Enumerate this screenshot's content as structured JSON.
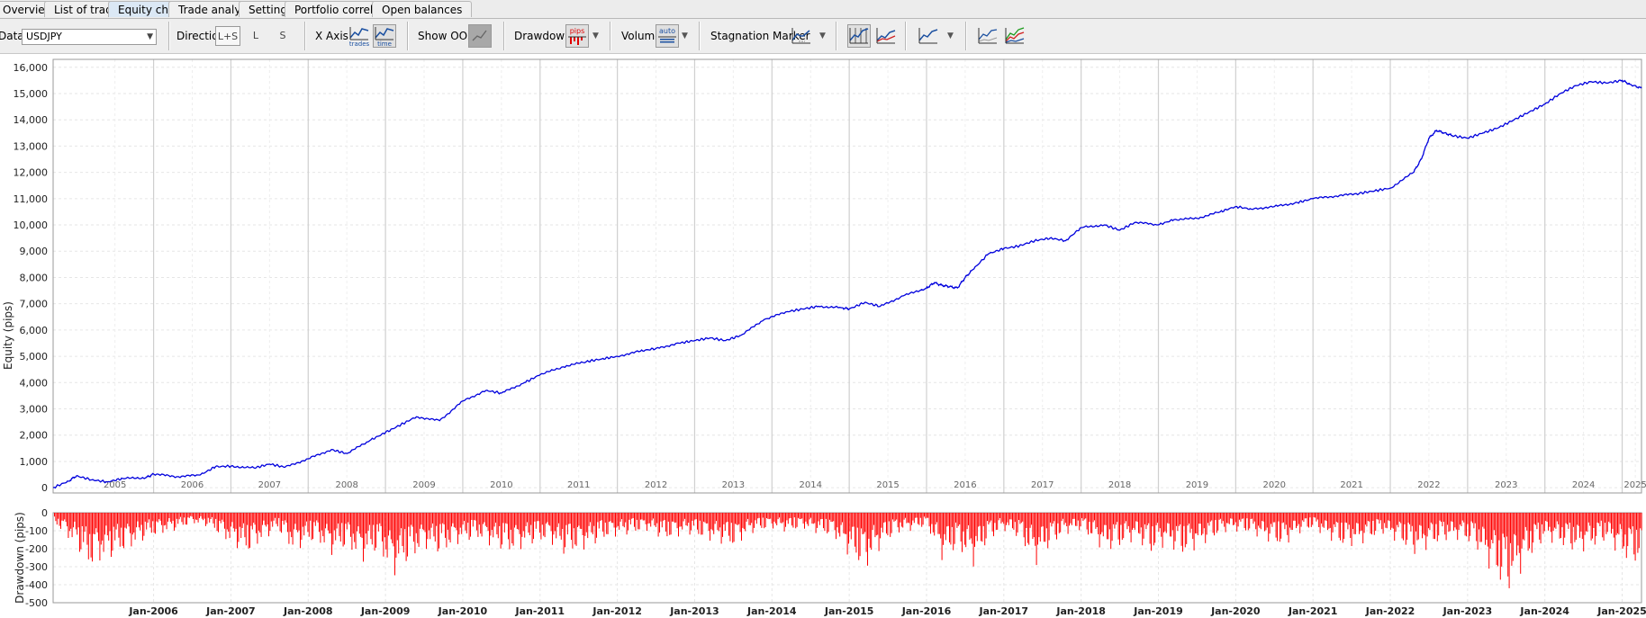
{
  "tabs": [
    {
      "label": "Overview",
      "active": false
    },
    {
      "label": "List of trades",
      "active": false
    },
    {
      "label": "Equity chart",
      "active": true
    },
    {
      "label": "Trade analysis",
      "active": false
    },
    {
      "label": "Settings",
      "active": false
    },
    {
      "label": "Portfolio correlation",
      "active": false
    },
    {
      "label": "Open balances",
      "active": false
    }
  ],
  "toolbar": {
    "data_label": "Data",
    "data_value": "USDJPY",
    "direction_label": "Direction",
    "direction_options": [
      "L+S",
      "L",
      "S"
    ],
    "direction_selected": "L+S",
    "xaxis_label": "X Axis",
    "xaxis_trades_icon_text": "trades",
    "xaxis_time_icon_text": "time",
    "show_oos_label": "Show OOS",
    "drawdown_label": "Drawdown",
    "drawdown_icon_text": "pips",
    "volume_label": "Volume",
    "volume_icon_text": "auto",
    "stagnation_label": "Stagnation Marker"
  },
  "colors": {
    "equity_line": "#0000dd",
    "drawdown_fill": "#ff0000",
    "active_tab": "#dbe8f5"
  },
  "chart_data": [
    {
      "type": "line",
      "ylabel": "Equity (pips)",
      "ylim": [
        -200,
        16300
      ],
      "yticks": [
        0,
        1000,
        2000,
        3000,
        4000,
        5000,
        6000,
        7000,
        8000,
        9000,
        10000,
        11000,
        12000,
        13000,
        14000,
        15000,
        16000
      ],
      "xlim": [
        2004.7,
        2025.25
      ],
      "year_labels": [
        "2005",
        "2006",
        "2007",
        "2008",
        "2009",
        "2010",
        "2011",
        "2012",
        "2013",
        "2014",
        "2015",
        "2016",
        "2017",
        "2018",
        "2019",
        "2020",
        "2021",
        "2022",
        "2023",
        "2024",
        "2025"
      ],
      "grid": true,
      "series": [
        {
          "x": [
            2004.7,
            2004.9,
            2005.0,
            2005.2,
            2005.4,
            2005.6,
            2005.9,
            2006.0,
            2006.3,
            2006.6,
            2006.8,
            2007.0,
            2007.3,
            2007.5,
            2007.7,
            2008.0,
            2008.3,
            2008.5,
            2008.8,
            2009.0,
            2009.2,
            2009.4,
            2009.7,
            2010.0,
            2010.3,
            2010.5,
            2010.8,
            2011.0,
            2011.3,
            2011.6,
            2011.8,
            2012.0,
            2012.3,
            2012.5,
            2012.8,
            2013.0,
            2013.2,
            2013.4,
            2013.6,
            2013.9,
            2014.2,
            2014.4,
            2014.6,
            2014.9,
            2015.0,
            2015.2,
            2015.4,
            2015.7,
            2016.0,
            2016.1,
            2016.2,
            2016.3,
            2016.4,
            2016.5,
            2016.6,
            2016.8,
            2017.0,
            2017.2,
            2017.4,
            2017.6,
            2017.8,
            2018.0,
            2018.3,
            2018.5,
            2018.7,
            2019.0,
            2019.2,
            2019.5,
            2019.8,
            2020.0,
            2020.2,
            2020.5,
            2020.8,
            2021.0,
            2021.3,
            2021.6,
            2021.8,
            2022.0,
            2022.3,
            2022.4,
            2022.5,
            2022.6,
            2022.7,
            2022.8,
            2023.0,
            2023.2,
            2023.4,
            2023.6,
            2023.8,
            2024.0,
            2024.2,
            2024.4,
            2024.6,
            2024.8,
            2025.0,
            2025.1,
            2025.25
          ],
          "y": [
            0,
            250,
            450,
            300,
            220,
            350,
            380,
            520,
            420,
            480,
            800,
            820,
            750,
            900,
            780,
            1100,
            1450,
            1300,
            1800,
            2100,
            2400,
            2700,
            2550,
            3300,
            3700,
            3600,
            4000,
            4300,
            4600,
            4800,
            4900,
            5000,
            5200,
            5300,
            5500,
            5600,
            5700,
            5600,
            5800,
            6400,
            6700,
            6800,
            6900,
            6850,
            6800,
            7050,
            6900,
            7300,
            7600,
            7800,
            7700,
            7650,
            7600,
            8000,
            8300,
            8900,
            9100,
            9200,
            9400,
            9500,
            9400,
            9900,
            10000,
            9800,
            10100,
            10000,
            10200,
            10250,
            10500,
            10700,
            10600,
            10700,
            10850,
            11000,
            11100,
            11200,
            11300,
            11400,
            12000,
            12500,
            13300,
            13600,
            13500,
            13400,
            13300,
            13500,
            13700,
            14000,
            14300,
            14600,
            15000,
            15300,
            15450,
            15400,
            15500,
            15350,
            15200
          ]
        }
      ]
    },
    {
      "type": "bar",
      "ylabel": "Drawdown (pips)",
      "ylim": [
        -500,
        0
      ],
      "yticks": [
        0,
        -100,
        -200,
        -300,
        -400,
        -500
      ],
      "month_labels": [
        "Jan-2006",
        "Jan-2007",
        "Jan-2008",
        "Jan-2009",
        "Jan-2010",
        "Jan-2011",
        "Jan-2012",
        "Jan-2013",
        "Jan-2014",
        "Jan-2015",
        "Jan-2016",
        "Jan-2017",
        "Jan-2018",
        "Jan-2019",
        "Jan-2020",
        "Jan-2021",
        "Jan-2022",
        "Jan-2023",
        "Jan-2024",
        "Jan-2025"
      ],
      "grid": true,
      "series": [
        {
          "x": [
            2004.75,
            2005.0,
            2005.15,
            2005.3,
            2005.5,
            2005.7,
            2005.9,
            2006.1,
            2006.3,
            2006.5,
            2006.7,
            2007.0,
            2007.2,
            2007.4,
            2007.6,
            2007.8,
            2008.1,
            2008.3,
            2008.5,
            2008.7,
            2008.9,
            2009.1,
            2009.3,
            2009.5,
            2009.7,
            2009.9,
            2010.2,
            2010.4,
            2010.6,
            2010.9,
            2011.1,
            2011.3,
            2011.5,
            2011.7,
            2011.9,
            2012.2,
            2012.4,
            2012.6,
            2012.9,
            2013.1,
            2013.3,
            2013.5,
            2013.7,
            2014.0,
            2014.2,
            2014.4,
            2014.6,
            2014.8,
            2015.0,
            2015.2,
            2015.4,
            2015.6,
            2015.8,
            2016.0,
            2016.2,
            2016.4,
            2016.6,
            2016.8,
            2017.0,
            2017.2,
            2017.4,
            2017.6,
            2017.8,
            2018.0,
            2018.3,
            2018.5,
            2018.7,
            2018.9,
            2019.1,
            2019.3,
            2019.5,
            2019.7,
            2019.9,
            2020.2,
            2020.4,
            2020.6,
            2020.8,
            2021.0,
            2021.2,
            2021.4,
            2021.6,
            2021.9,
            2022.1,
            2022.3,
            2022.5,
            2022.7,
            2022.9,
            2023.1,
            2023.3,
            2023.5,
            2023.65,
            2023.8,
            2024.0,
            2024.2,
            2024.4,
            2024.6,
            2024.8,
            2025.0,
            2025.2
          ],
          "y": [
            -80,
            -200,
            -320,
            -280,
            -250,
            -200,
            -150,
            -120,
            -100,
            -60,
            -80,
            -180,
            -240,
            -160,
            -100,
            -220,
            -160,
            -240,
            -200,
            -280,
            -220,
            -360,
            -280,
            -200,
            -240,
            -180,
            -150,
            -200,
            -230,
            -180,
            -160,
            -240,
            -220,
            -180,
            -140,
            -120,
            -100,
            -160,
            -120,
            -150,
            -170,
            -200,
            -120,
            -90,
            -110,
            -90,
            -120,
            -140,
            -250,
            -330,
            -200,
            -120,
            -100,
            -80,
            -270,
            -210,
            -300,
            -160,
            -100,
            -150,
            -300,
            -190,
            -120,
            -100,
            -220,
            -200,
            -150,
            -240,
            -180,
            -250,
            -200,
            -150,
            -100,
            -120,
            -160,
            -200,
            -120,
            -90,
            -150,
            -200,
            -180,
            -120,
            -170,
            -240,
            -200,
            -160,
            -150,
            -200,
            -330,
            -470,
            -360,
            -260,
            -150,
            -190,
            -230,
            -200,
            -160,
            -260,
            -300
          ]
        }
      ]
    }
  ]
}
